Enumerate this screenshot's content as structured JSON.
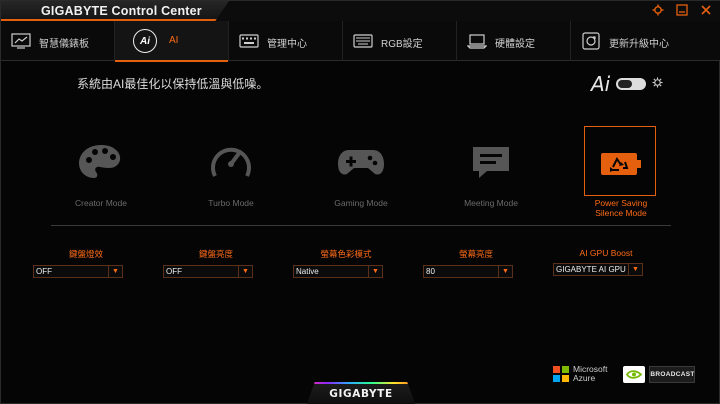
{
  "window": {
    "title": "GIGABYTE Control Center",
    "controls": [
      "settings-icon",
      "minimize-icon",
      "close-icon"
    ]
  },
  "tabs": [
    {
      "label": "智慧儀錶板",
      "icon": "dashboard-icon",
      "active": false
    },
    {
      "label": "AI",
      "icon": "ai-icon",
      "icon_text": "Ai",
      "active": true
    },
    {
      "label": "管理中心",
      "icon": "keyboard-icon",
      "active": false
    },
    {
      "label": "RGB設定",
      "icon": "rgb-keyboard-icon",
      "active": false
    },
    {
      "label": "硬體設定",
      "icon": "laptop-icon",
      "active": false
    },
    {
      "label": "更新升級中心",
      "icon": "update-icon",
      "active": false
    }
  ],
  "main": {
    "description": "系統由AI最佳化以保持低溫與低噪。",
    "ai_logo": "Ai",
    "ai_toggle": "on",
    "modes": [
      {
        "label": "Creator Mode",
        "icon": "palette-icon",
        "active": false
      },
      {
        "label": "Turbo Mode",
        "icon": "speedometer-icon",
        "active": false
      },
      {
        "label": "Gaming Mode",
        "icon": "gamepad-icon",
        "active": false
      },
      {
        "label": "Meeting Mode",
        "icon": "chat-icon",
        "active": false
      },
      {
        "label": "Power Saving",
        "label2": "Silence Mode",
        "icon": "battery-recycle-icon",
        "active": true
      }
    ],
    "dropdowns": [
      {
        "label": "鍵盤燈效",
        "value": "OFF"
      },
      {
        "label": "鍵盤亮度",
        "value": "OFF"
      },
      {
        "label": "螢幕色彩模式",
        "value": "Native"
      },
      {
        "label": "螢幕亮度",
        "value": "80"
      },
      {
        "label": "AI GPU Boost",
        "value": "GIGABYTE AI GPU"
      }
    ]
  },
  "footer": {
    "microsoft": {
      "line1": "Microsoft",
      "line2": "Azure"
    },
    "nvidia": {
      "label": "BROADCAST"
    },
    "brand": "GIGABYTE"
  },
  "colors": {
    "accent": "#e5600e",
    "accent_text": "#ff6b16",
    "background": "#050505",
    "inactive_mode": "#6b6b6b"
  }
}
